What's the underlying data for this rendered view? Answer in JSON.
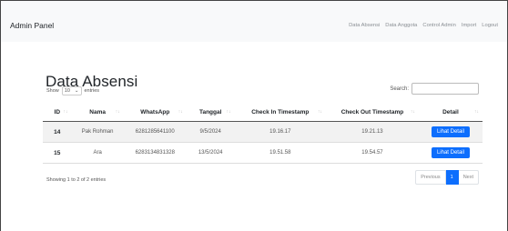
{
  "navbar": {
    "brand": "Admin Panel",
    "links": [
      "Data Absensi",
      "Data Anggota",
      "Control Admin",
      "Import",
      "Logout"
    ]
  },
  "page": {
    "title": "Data Absensi",
    "length": {
      "show_label": "Show",
      "value": "10",
      "entries_label": "entries"
    },
    "search_label": "Search:",
    "search_value": ""
  },
  "table": {
    "columns": [
      "ID",
      "Nama",
      "WhatsApp",
      "Tanggal",
      "Check In Timestamp",
      "Check Out Timestamp",
      "Detail"
    ],
    "rows": [
      {
        "id": "14",
        "nama": "Pak Rohman",
        "whatsapp": "6281285641100",
        "tanggal": "9/5/2024",
        "check_in": "19.16.17",
        "check_out": "19.21.13",
        "detail": "Lihat Detail"
      },
      {
        "id": "15",
        "nama": "Ara",
        "whatsapp": "6283134831328",
        "tanggal": "13/5/2024",
        "check_in": "19.51.58",
        "check_out": "19.54.57",
        "detail": "Lihat Detail"
      }
    ]
  },
  "footer": {
    "info": "Showing 1 to 2 of 2 entries",
    "pagination": {
      "previous": "Previous",
      "current": "1",
      "next": "Next"
    }
  },
  "colors": {
    "accent": "#0d6efd",
    "navbar_bg": "#f8f9fa"
  },
  "icons": {
    "sort": "sort-arrows-icon",
    "dropdown": "chevron-down-icon"
  }
}
